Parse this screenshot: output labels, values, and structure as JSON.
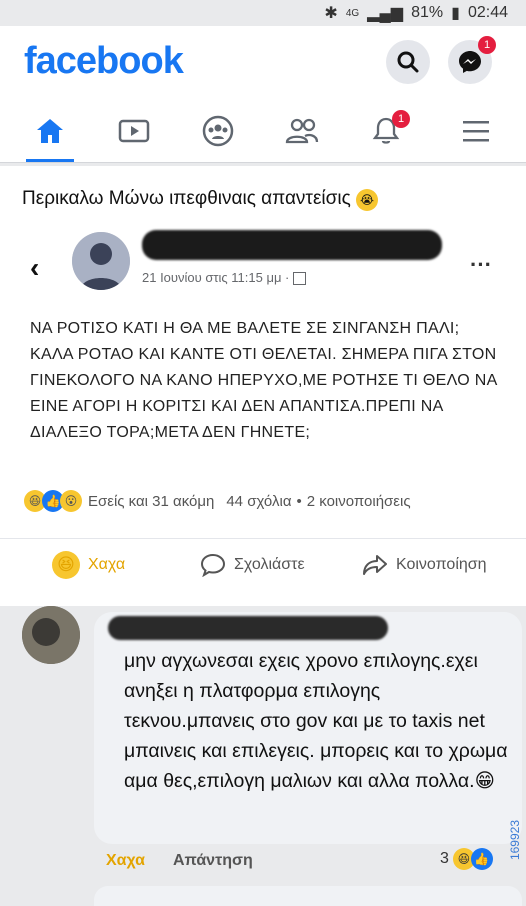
{
  "status_bar": {
    "battery": "81%",
    "time": "02:44",
    "network": "4G"
  },
  "header": {
    "logo": "facebook",
    "messenger_badge": "1"
  },
  "tabs": [
    {
      "name": "home-icon"
    },
    {
      "name": "watch-icon"
    },
    {
      "name": "groups-icon"
    },
    {
      "name": "friends-icon"
    },
    {
      "name": "notifications-icon",
      "badge": "1"
    },
    {
      "name": "menu-icon"
    }
  ],
  "post": {
    "group_title": "Περικαλω Μώνω ιπεφθιναις απαντείσις",
    "date": "21 Ιουνίου στις 11:15 μμ ·",
    "body": "ΝΑ ΡΟΤΙΣΟ ΚΑΤΙ Η ΘΑ ΜΕ ΒΑΛΕΤΕ ΣΕ ΣΙΝΓΑΝΣΗ ΠΑΛΙ; ΚΑΛΑ ΡΟΤΑΟ ΚΑΙ ΚΑΝΤΕ ΟΤΙ ΘΕΛΕΤΑΙ. ΣΗΜΕΡΑ ΠΙΓΑ ΣΤΟΝ ΓΙΝΕΚΟΛΟΓΟ ΝΑ ΚΑΝΟ ΗΠΕΡΥΧΟ,ΜΕ ΡΟΤΗΣΕ ΤΙ ΘΕΛΟ ΝΑ ΕΙΝΕ ΑΓΟΡΙ Η ΚΟΡΙΤΣΙ ΚΑΙ ΔΕΝ ΑΠΑΝΤΙΣΑ.ΠΡΕΠΙ ΝΑ ΔΙΑΛΕΞΟ ΤΟΡΑ;ΜΕΤΑ ΔΕΝ ΓΗΝΕΤΕ;",
    "reactions_text": "Εσείς και 31 ακόμη",
    "comments_count": "44 σχόλια",
    "shares": "2 κοινοποιήσεις",
    "actions": {
      "haha": "Χαχα",
      "comment": "Σχολιάστε",
      "share": "Κοινοποίηση"
    }
  },
  "comment": {
    "text": "μην αγχωνεσαι εχεις χρονο επιλογης.εχει ανηξει η πλατφορμα επιλογης τεκνου.μπανεις στο gov και με το taxis  net μπαινεις και επιλεγεις. μπορεις και το χρωμα αμα θες,επιλογη μαλιων και αλλα πολλα.😁",
    "haha_label": "Χαχα",
    "reply_label": "Απάντηση",
    "reaction_count": "3"
  },
  "watermark": "169923"
}
